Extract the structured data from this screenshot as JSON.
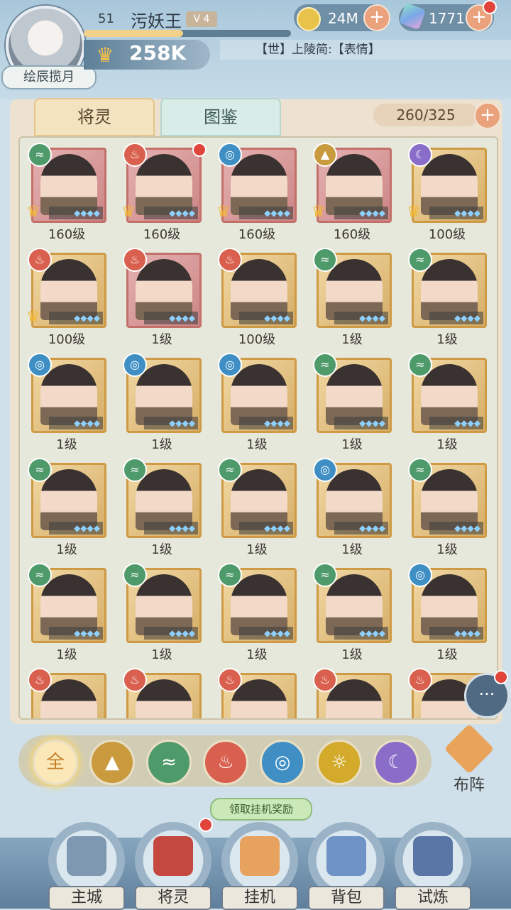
{
  "player": {
    "level": "51",
    "name": "污妖王",
    "vip": "V 4",
    "exp_fraction": 0.48,
    "power": "258K",
    "avatar_title": "绘辰揽月"
  },
  "resources": {
    "coins": "24M",
    "gems": "1771"
  },
  "chat_message": "【世】上陵简:【表情】",
  "tabs": [
    "将灵",
    "图鉴"
  ],
  "roster_count": "260/325",
  "heroes": [
    {
      "element": "wind",
      "level": "160级",
      "frame": "red",
      "crown": true,
      "dot": false
    },
    {
      "element": "fire",
      "level": "160级",
      "frame": "red",
      "crown": true,
      "dot": true
    },
    {
      "element": "water",
      "level": "160级",
      "frame": "red",
      "crown": true,
      "dot": false
    },
    {
      "element": "mountain",
      "level": "160级",
      "frame": "red",
      "crown": true,
      "dot": false
    },
    {
      "element": "dark",
      "level": "100级",
      "frame": "gold",
      "crown": true,
      "dot": false
    },
    {
      "element": "fire",
      "level": "100级",
      "frame": "gold",
      "crown": true,
      "dot": false
    },
    {
      "element": "fire",
      "level": "1级",
      "frame": "red",
      "crown": false,
      "dot": false
    },
    {
      "element": "fire",
      "level": "100级",
      "frame": "gold",
      "crown": false,
      "dot": false
    },
    {
      "element": "wind",
      "level": "1级",
      "frame": "gold",
      "crown": false,
      "dot": false
    },
    {
      "element": "wind",
      "level": "1级",
      "frame": "gold",
      "crown": false,
      "dot": false
    },
    {
      "element": "water",
      "level": "1级",
      "frame": "gold",
      "crown": false,
      "dot": false
    },
    {
      "element": "water",
      "level": "1级",
      "frame": "gold",
      "crown": false,
      "dot": false
    },
    {
      "element": "water",
      "level": "1级",
      "frame": "gold",
      "crown": false,
      "dot": false
    },
    {
      "element": "wind",
      "level": "1级",
      "frame": "gold",
      "crown": false,
      "dot": false
    },
    {
      "element": "wind",
      "level": "1级",
      "frame": "gold",
      "crown": false,
      "dot": false
    },
    {
      "element": "wind",
      "level": "1级",
      "frame": "gold",
      "crown": false,
      "dot": false
    },
    {
      "element": "wind",
      "level": "1级",
      "frame": "gold",
      "crown": false,
      "dot": false
    },
    {
      "element": "wind",
      "level": "1级",
      "frame": "gold",
      "crown": false,
      "dot": false
    },
    {
      "element": "water",
      "level": "1级",
      "frame": "gold",
      "crown": false,
      "dot": false
    },
    {
      "element": "wind",
      "level": "1级",
      "frame": "gold",
      "crown": false,
      "dot": false
    },
    {
      "element": "wind",
      "level": "1级",
      "frame": "gold",
      "crown": false,
      "dot": false
    },
    {
      "element": "wind",
      "level": "1级",
      "frame": "gold",
      "crown": false,
      "dot": false
    },
    {
      "element": "wind",
      "level": "1级",
      "frame": "gold",
      "crown": false,
      "dot": false
    },
    {
      "element": "wind",
      "level": "1级",
      "frame": "gold",
      "crown": false,
      "dot": false
    },
    {
      "element": "water",
      "level": "1级",
      "frame": "gold",
      "crown": false,
      "dot": false
    },
    {
      "element": "fire",
      "level": "",
      "frame": "gold",
      "crown": false,
      "dot": false
    },
    {
      "element": "fire",
      "level": "",
      "frame": "gold",
      "crown": false,
      "dot": false
    },
    {
      "element": "fire",
      "level": "",
      "frame": "gold",
      "crown": false,
      "dot": false
    },
    {
      "element": "fire",
      "level": "",
      "frame": "gold",
      "crown": false,
      "dot": false
    },
    {
      "element": "fire",
      "level": "",
      "frame": "gold",
      "crown": false,
      "dot": false
    }
  ],
  "element_colors": {
    "wind": "#4f9a6b",
    "fire": "#d9604e",
    "water": "#3f8fc4",
    "mountain": "#c99a3e",
    "dark": "#8a6cc9",
    "light": "#d4aa2a",
    "all": "#f0b04a"
  },
  "filters": [
    {
      "key": "all",
      "label": "全",
      "icon": "all-icon"
    },
    {
      "key": "mountain",
      "label": "",
      "icon": "mountain-icon"
    },
    {
      "key": "wind",
      "label": "",
      "icon": "wind-icon"
    },
    {
      "key": "fire",
      "label": "",
      "icon": "fire-icon"
    },
    {
      "key": "water",
      "label": "",
      "icon": "water-icon"
    },
    {
      "key": "light",
      "label": "",
      "icon": "sun-icon"
    },
    {
      "key": "dark",
      "label": "",
      "icon": "dark-icon"
    }
  ],
  "lineup_label": "布阵",
  "idle_reward_tip": "领取挂机奖励",
  "nav": [
    {
      "label": "主城",
      "icon": "city-icon",
      "color": "#7f98b1",
      "dot": false
    },
    {
      "label": "将灵",
      "icon": "helmet-icon",
      "color": "#c4483f",
      "dot": true
    },
    {
      "label": "挂机",
      "icon": "crossed-swords-icon",
      "color": "#e7a260",
      "dot": false
    },
    {
      "label": "背包",
      "icon": "bag-icon",
      "color": "#6f93c7",
      "dot": false
    },
    {
      "label": "试炼",
      "icon": "banner-icon",
      "color": "#5a76a6",
      "dot": false
    }
  ]
}
